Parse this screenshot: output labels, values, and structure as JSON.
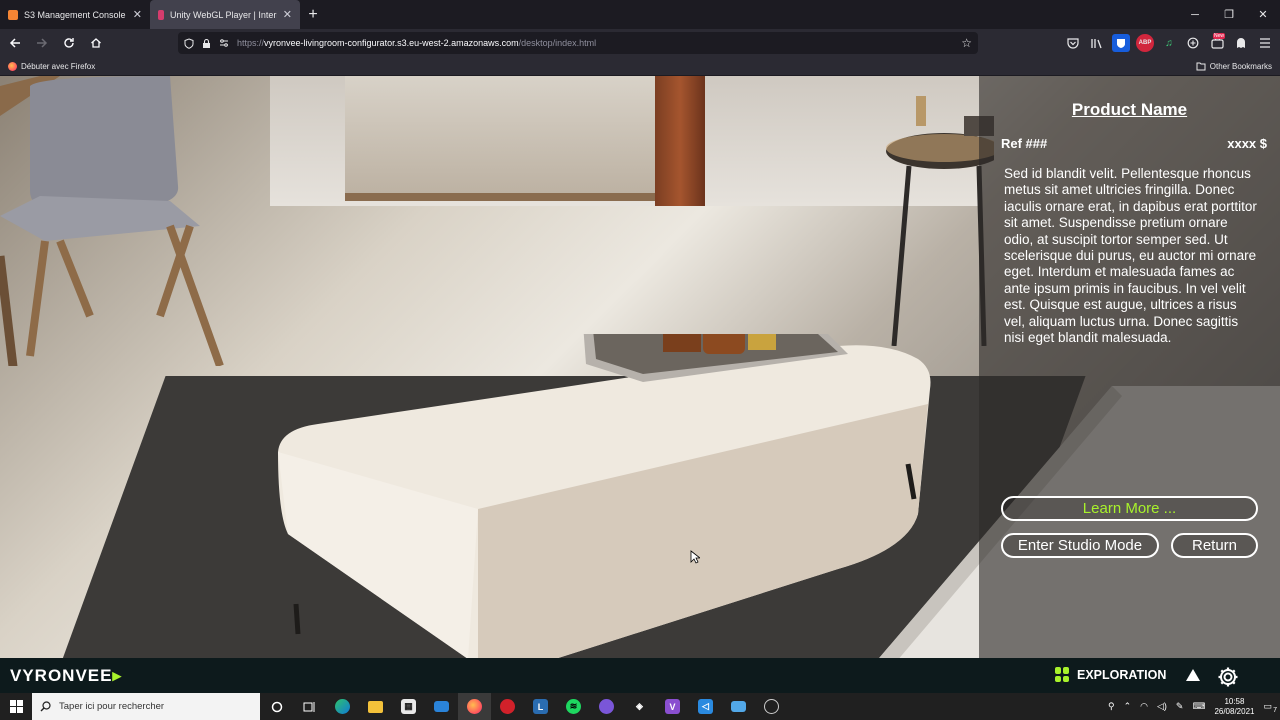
{
  "browser": {
    "tabs": [
      {
        "title": "S3 Management Console",
        "icon": "aws-icon",
        "active": false
      },
      {
        "title": "Unity WebGL Player | Interior C...",
        "icon": "unity-icon",
        "active": true
      }
    ],
    "new_tab_label": "+",
    "url": {
      "prefix": "https://",
      "host": "vyronvee-livingroom-configurator.s3.eu-west-2.amazonaws.com",
      "path": "/desktop/index.html"
    },
    "bookmarks": {
      "left": "Débuter avec Firefox",
      "right": "Other Bookmarks"
    },
    "extensions": [
      "pocket-icon",
      "library-icon",
      "bitwarden-icon",
      "adblock-icon",
      "music-icon",
      "vpn-icon",
      "extension-icon",
      "new-badge-icon",
      "ghostery-icon",
      "menu-icon"
    ],
    "new_badge": "New"
  },
  "product_panel": {
    "name": "Product Name",
    "ref": "Ref ###",
    "price": "xxxx $",
    "description": "Sed id blandit velit. Pellentesque rhoncus metus sit amet ultricies fringilla. Donec iaculis ornare erat, in dapibus erat porttitor sit amet. Suspendisse pretium ornare odio, at suscipit tortor semper sed. Ut scelerisque dui purus, eu auctor mi ornare eget. Interdum et malesuada fames ac ante ipsum primis in faucibus. In vel velit est. Quisque est augue, ultrices a risus vel, aliquam luctus urna. Donec sagittis nisi eget blandit malesuada.",
    "learn_more": "Learn More ...",
    "studio_mode": "Enter Studio Mode",
    "return": "Return"
  },
  "app_bar": {
    "logo_main": "VYRONVEE",
    "logo_accent": "▸",
    "mode_label": "EXPLORATION"
  },
  "taskbar": {
    "search_placeholder": "Taper ici pour rechercher",
    "time": "10:58",
    "date": "26/08/2021",
    "notification_count": "7"
  },
  "colors": {
    "accent_green": "#a8f22b",
    "panel_bg": "rgba(45,42,40,0.62)"
  }
}
